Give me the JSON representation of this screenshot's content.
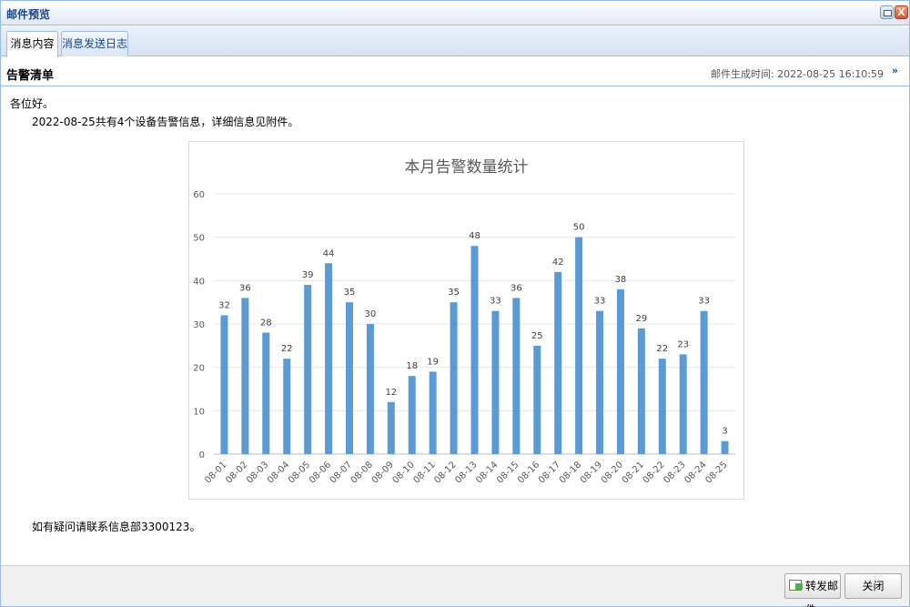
{
  "window": {
    "title": "邮件预览",
    "close_glyph": "X"
  },
  "tabs": [
    {
      "label": "消息内容",
      "active": true
    },
    {
      "label": "消息发送日志",
      "active": false
    }
  ],
  "section": {
    "title": "告警清单",
    "generated_time": "邮件生成时间: 2022-08-25 16:10:59",
    "collapse_glyph": "»"
  },
  "message": {
    "greeting": "各位好。",
    "line": "2022-08-25共有4个设备告警信息，详细信息见附件。",
    "contact": "如有疑问请联系信息部3300123。"
  },
  "footer": {
    "forward_label": "转发邮件",
    "close_label": "关闭"
  },
  "colors": {
    "bar": "#5b9bd5",
    "accent": "#15428b",
    "border": "#99bbe8"
  },
  "chart_data": {
    "type": "bar",
    "title": "本月告警数量统计",
    "categories": [
      "08-01",
      "08-02",
      "08-03",
      "08-04",
      "08-05",
      "08-06",
      "08-07",
      "08-08",
      "08-09",
      "08-10",
      "08-11",
      "08-12",
      "08-13",
      "08-14",
      "08-15",
      "08-16",
      "08-17",
      "08-18",
      "08-19",
      "08-20",
      "08-21",
      "08-22",
      "08-23",
      "08-24",
      "08-25"
    ],
    "values": [
      32,
      36,
      28,
      22,
      39,
      44,
      35,
      30,
      12,
      18,
      19,
      35,
      48,
      33,
      36,
      25,
      42,
      50,
      33,
      38,
      29,
      22,
      23,
      33,
      3
    ],
    "ylim": [
      0,
      60
    ],
    "yticks": [
      0,
      10,
      20,
      30,
      40,
      50,
      60
    ],
    "grid": true,
    "data_labels": true
  }
}
